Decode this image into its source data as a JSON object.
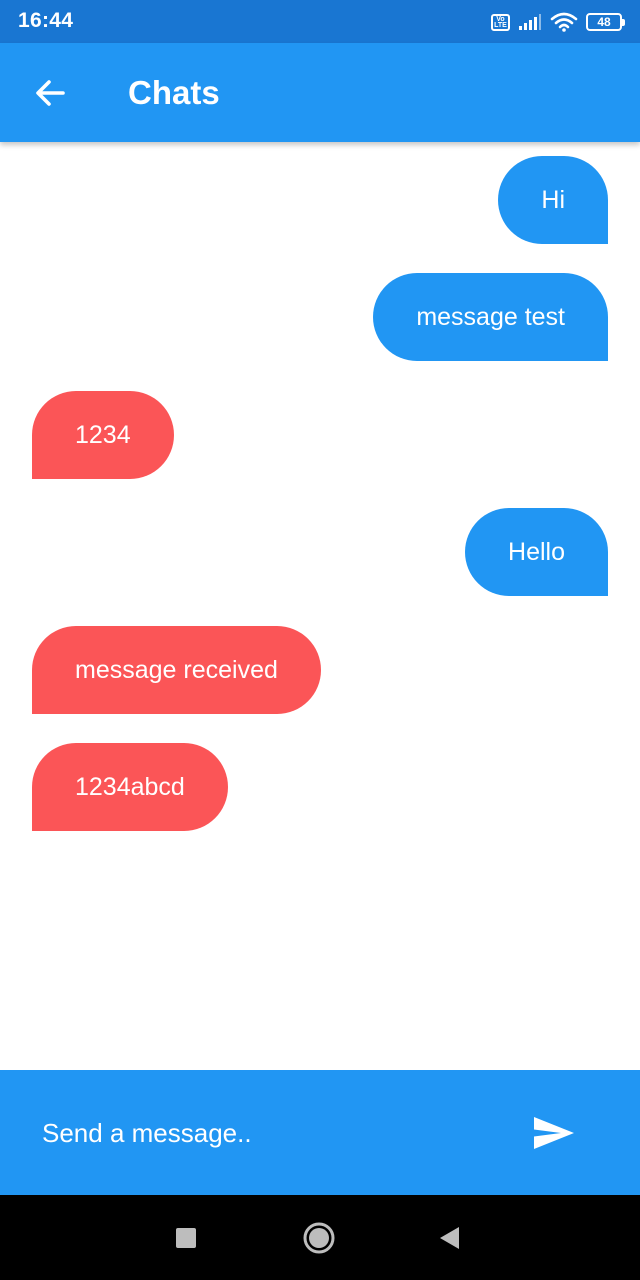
{
  "status_bar": {
    "time": "16:44",
    "volte_label": "Vo LTE",
    "battery_level": "48",
    "icons": [
      "volte-icon",
      "signal-icon",
      "wifi-icon",
      "battery-icon"
    ]
  },
  "app_bar": {
    "title": "Chats",
    "back_icon": "arrow-left-icon"
  },
  "messages": [
    {
      "text": "Hi",
      "direction": "sent"
    },
    {
      "text": "message test",
      "direction": "sent"
    },
    {
      "text": "1234",
      "direction": "received"
    },
    {
      "text": "Hello",
      "direction": "sent"
    },
    {
      "text": "message received",
      "direction": "received"
    },
    {
      "text": "1234abcd",
      "direction": "received"
    }
  ],
  "composer": {
    "placeholder": "Send a message..",
    "value": "",
    "send_icon": "send-icon"
  },
  "nav_bar": {
    "icons": [
      "recents-icon",
      "home-icon",
      "back-icon"
    ]
  },
  "colors": {
    "status_bar": "#1976d2",
    "primary": "#2196f3",
    "sent_bubble": "#2196f3",
    "received_bubble": "#fb5557",
    "nav_bar": "#000000"
  }
}
